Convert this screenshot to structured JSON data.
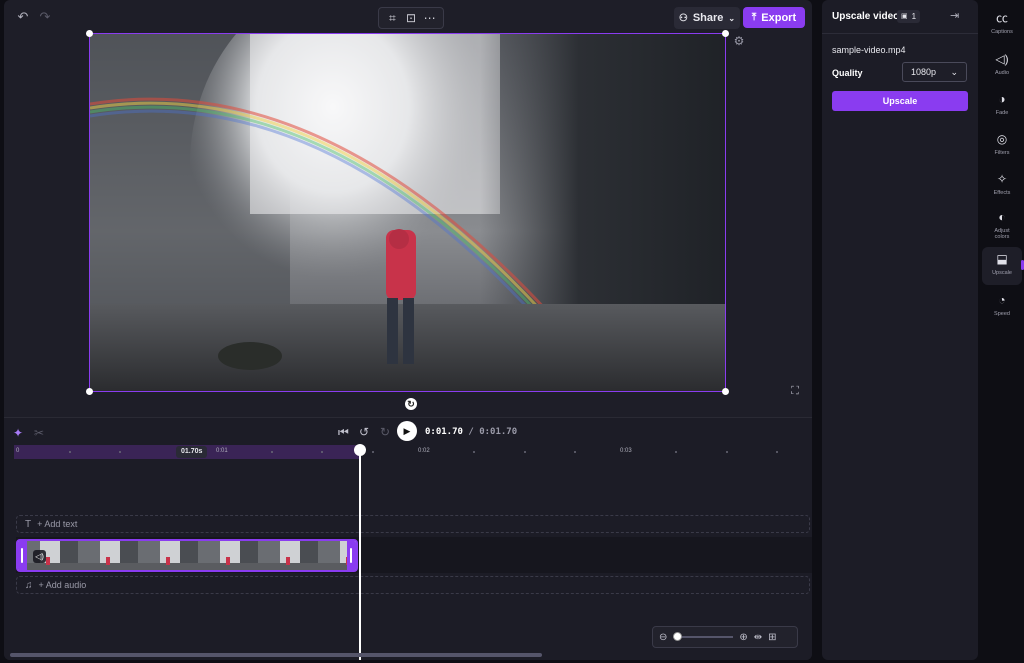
{
  "toolbar": {
    "share_label": "Share",
    "export_label": "Export"
  },
  "timeline": {
    "current_time": "0:01.70",
    "total_time": "/ 0:01.70",
    "badge_time": "01.70s",
    "ticks": [
      "0",
      "0:01",
      "0:02",
      "0:03"
    ],
    "add_text_label": "+ Add text",
    "add_audio_label": "+ Add audio"
  },
  "panel": {
    "title": "Upscale video",
    "count": "1",
    "file_name": "sample-video.mp4",
    "quality_label": "Quality",
    "quality_value": "1080p",
    "upscale_button": "Upscale"
  },
  "rail": {
    "captions": "Captions",
    "audio": "Audio",
    "fade": "Fade",
    "filters": "Filters",
    "effects": "Effects",
    "adjust_colors": "Adjust colors",
    "upscale": "Upscale",
    "speed": "Speed"
  },
  "colors": {
    "accent": "#8a3cf0",
    "background": "#0e0e14",
    "panel": "#1e1e28"
  }
}
